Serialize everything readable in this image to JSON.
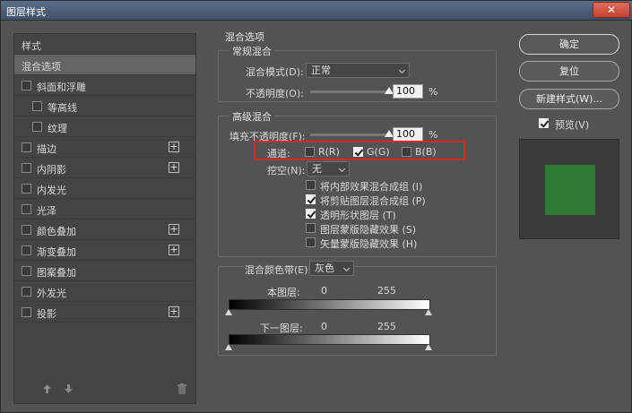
{
  "window": {
    "title": "图层样式",
    "close_glyph": "✕"
  },
  "left_list": {
    "header": "样式",
    "items": [
      {
        "label": "混合选项",
        "has_checkbox": false,
        "checked": false,
        "has_plus": false,
        "selected": true
      },
      {
        "label": "斜面和浮雕",
        "has_checkbox": true,
        "checked": false,
        "has_plus": false
      },
      {
        "label": "等高线",
        "has_checkbox": true,
        "checked": false,
        "has_plus": false,
        "indent": true
      },
      {
        "label": "纹理",
        "has_checkbox": true,
        "checked": false,
        "has_plus": false,
        "indent": true
      },
      {
        "label": "描边",
        "has_checkbox": true,
        "checked": false,
        "has_plus": true
      },
      {
        "label": "内阴影",
        "has_checkbox": true,
        "checked": false,
        "has_plus": true
      },
      {
        "label": "内发光",
        "has_checkbox": true,
        "checked": false,
        "has_plus": false
      },
      {
        "label": "光泽",
        "has_checkbox": true,
        "checked": false,
        "has_plus": false
      },
      {
        "label": "颜色叠加",
        "has_checkbox": true,
        "checked": false,
        "has_plus": true
      },
      {
        "label": "渐变叠加",
        "has_checkbox": true,
        "checked": false,
        "has_plus": true
      },
      {
        "label": "图案叠加",
        "has_checkbox": true,
        "checked": false,
        "has_plus": false
      },
      {
        "label": "外发光",
        "has_checkbox": true,
        "checked": false,
        "has_plus": false
      },
      {
        "label": "投影",
        "has_checkbox": true,
        "checked": false,
        "has_plus": true
      }
    ],
    "footer_icons": [
      "arrow-up-icon",
      "arrow-down-icon",
      "trash-icon"
    ]
  },
  "blend_options": {
    "section_title": "混合选项",
    "general": {
      "title": "常规混合",
      "mode_label": "混合模式(D):",
      "mode_value": "正常",
      "opacity_label": "不透明度(O):",
      "opacity_value": "100",
      "opacity_unit": "%",
      "opacity_fraction": 1.0
    },
    "advanced": {
      "title": "高级混合",
      "fill_label": "填充不透明度(F):",
      "fill_value": "100",
      "fill_unit": "%",
      "fill_fraction": 1.0,
      "channels_label": "通道:",
      "channels": [
        {
          "label": "R(R)",
          "checked": false
        },
        {
          "label": "G(G)",
          "checked": true
        },
        {
          "label": "B(B)",
          "checked": false
        }
      ],
      "knockout_label": "挖空(N):",
      "knockout_value": "无",
      "options": [
        {
          "label": "将内部效果混合成组 (I)",
          "checked": false
        },
        {
          "label": "将剪贴图层混合成组 (P)",
          "checked": true
        },
        {
          "label": "透明形状图层 (T)",
          "checked": true
        },
        {
          "label": "图层蒙版隐藏效果 (S)",
          "checked": false
        },
        {
          "label": "矢量蒙版隐藏效果 (H)",
          "checked": false
        }
      ]
    },
    "blend_if": {
      "label": "混合颜色带(E):",
      "value": "灰色",
      "this_layer_label": "本图层:",
      "this_layer_min": "0",
      "this_layer_max": "255",
      "underlying_label": "下一图层:",
      "underlying_min": "0",
      "underlying_max": "255"
    }
  },
  "right_panel": {
    "ok_label": "确定",
    "reset_label": "复位",
    "new_style_label": "新建样式(W)...",
    "preview_label": "预览(V)",
    "preview_checked": true,
    "preview_swatch_color": "#2e7d32"
  },
  "highlight_color": "#e2232a"
}
